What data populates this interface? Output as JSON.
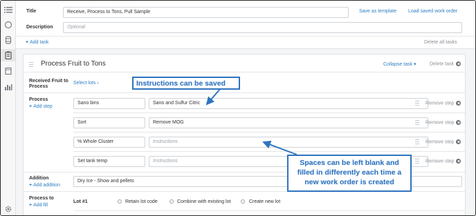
{
  "rail": {
    "icons": [
      "list-icon",
      "circle-icon",
      "barrel-icon",
      "clipboard-icon",
      "tank-icon",
      "bar-chart-icon",
      "settings-icon"
    ]
  },
  "header": {
    "title_label": "Title",
    "title_value": "Receive, Process to Tons, Pull Sample",
    "save_template": "Save as template",
    "load_saved": "Load saved work order",
    "description_label": "Description",
    "description_placeholder": "Optional",
    "add_task": "Add task",
    "delete_all": "Delete all tasks"
  },
  "task": {
    "title": "Process Fruit to Tons",
    "collapse": "Collapse task",
    "delete": "Delete task",
    "received_label": "Received Fruit to Process",
    "select_lots": "Select lots",
    "process_label": "Process",
    "add_step": "Add step",
    "remove_step": "Remove step",
    "steps": [
      {
        "name": "Sano bins",
        "instructions": "Sano and Sulfur Citric",
        "placeholder": "Instructions"
      },
      {
        "name": "Sort",
        "instructions": "Remove MOG",
        "placeholder": "Instructions"
      },
      {
        "name": "% Whole Cluster",
        "instructions": "",
        "placeholder": "Instructions"
      },
      {
        "name": "Set tank temp",
        "instructions": "",
        "placeholder": "Instructions"
      }
    ],
    "addition_label": "Addition",
    "add_addition": "Add addition",
    "addition_value": "Dry Ice - Show and pellets",
    "process_to_label": "Process to",
    "add_fill": "Add fill",
    "lot_label": "Lot #1",
    "radio_options": [
      "Retain lot code",
      "Combine with existing lot",
      "Create new lot"
    ]
  },
  "callouts": {
    "saved": "Instructions can be saved",
    "blank": "Spaces can be left blank and filled in differently each time a new work order is created"
  },
  "colors": {
    "accent": "#2b7fc4",
    "callout": "#2f74c0"
  }
}
